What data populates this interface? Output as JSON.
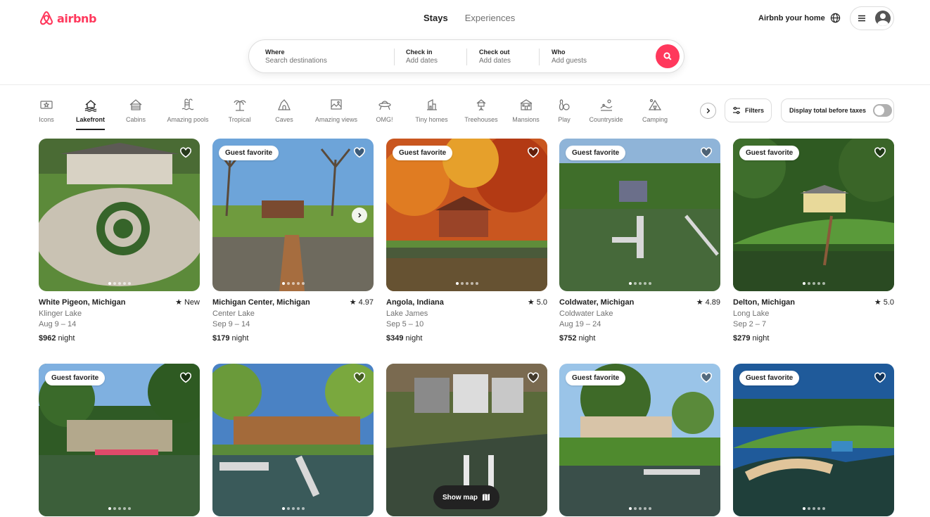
{
  "brand": {
    "name": "airbnb",
    "color": "#ff385c"
  },
  "nav": {
    "tabs": [
      {
        "label": "Stays",
        "active": true
      },
      {
        "label": "Experiences",
        "active": false
      }
    ]
  },
  "header_right": {
    "host_label": "Airbnb your home",
    "globe_icon": "globe-icon",
    "menu_icon": "menu-icon"
  },
  "search": {
    "where": {
      "label": "Where",
      "placeholder": "Search destinations"
    },
    "check_in": {
      "label": "Check in",
      "placeholder": "Add dates"
    },
    "check_out": {
      "label": "Check out",
      "placeholder": "Add dates"
    },
    "who": {
      "label": "Who",
      "placeholder": "Add guests"
    }
  },
  "categories": [
    {
      "label": "Icons",
      "icon": "icons-icon",
      "active": false
    },
    {
      "label": "Lakefront",
      "icon": "lakefront-icon",
      "active": true
    },
    {
      "label": "Cabins",
      "icon": "cabin-icon",
      "active": false
    },
    {
      "label": "Amazing pools",
      "icon": "pool-icon",
      "active": false
    },
    {
      "label": "Tropical",
      "icon": "palm-icon",
      "active": false
    },
    {
      "label": "Caves",
      "icon": "cave-icon",
      "active": false
    },
    {
      "label": "Amazing views",
      "icon": "view-icon",
      "active": false
    },
    {
      "label": "OMG!",
      "icon": "ufo-icon",
      "active": false
    },
    {
      "label": "Tiny homes",
      "icon": "tiny-home-icon",
      "active": false
    },
    {
      "label": "Treehouses",
      "icon": "treehouse-icon",
      "active": false
    },
    {
      "label": "Mansions",
      "icon": "mansion-icon",
      "active": false
    },
    {
      "label": "Play",
      "icon": "bowling-icon",
      "active": false
    },
    {
      "label": "Countryside",
      "icon": "countryside-icon",
      "active": false
    },
    {
      "label": "Camping",
      "icon": "tent-icon",
      "active": false
    }
  ],
  "filters": {
    "filters_label": "Filters",
    "taxes_label": "Display total before taxes"
  },
  "listings": [
    {
      "place": "White Pigeon, Michigan",
      "rating": "New",
      "sub": "Klinger Lake",
      "dates": "Aug 9 – 14",
      "price": "$962",
      "per": "night",
      "badge": ""
    },
    {
      "place": "Michigan Center, Michigan",
      "rating": "4.97",
      "sub": "Center Lake",
      "dates": "Sep 9 – 14",
      "price": "$179",
      "per": "night",
      "badge": "Guest favorite"
    },
    {
      "place": "Angola, Indiana",
      "rating": "5.0",
      "sub": "Lake James",
      "dates": "Sep 5 – 10",
      "price": "$349",
      "per": "night",
      "badge": "Guest favorite"
    },
    {
      "place": "Coldwater, Michigan",
      "rating": "4.89",
      "sub": "Coldwater Lake",
      "dates": "Aug 19 – 24",
      "price": "$752",
      "per": "night",
      "badge": "Guest favorite"
    },
    {
      "place": "Delton, Michigan",
      "rating": "5.0",
      "sub": "Long Lake",
      "dates": "Sep 2 – 7",
      "price": "$279",
      "per": "night",
      "badge": "Guest favorite"
    },
    {
      "badge": "Guest favorite"
    },
    {
      "badge": ""
    },
    {
      "badge": ""
    },
    {
      "badge": "Guest favorite"
    },
    {
      "badge": "Guest favorite"
    }
  ],
  "show_map": {
    "label": "Show map",
    "icon": "map-icon"
  }
}
